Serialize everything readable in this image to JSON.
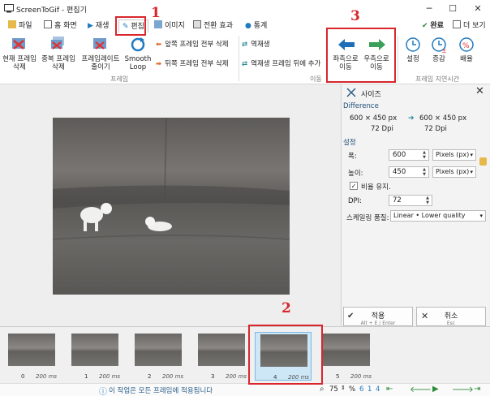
{
  "window": {
    "title": "ScreenToGif - 편집기",
    "controls": {
      "minimize": "─",
      "maximize": "☐",
      "close": "✕"
    }
  },
  "tabs": [
    {
      "label": "파일"
    },
    {
      "label": "홈 화면"
    },
    {
      "label": "재생"
    },
    {
      "label": "편집"
    },
    {
      "label": "이미지"
    },
    {
      "label": "전환 효과"
    },
    {
      "label": "통계"
    }
  ],
  "tabbar_right": {
    "done": "완료",
    "more": "더 보기"
  },
  "ribbon": {
    "frame_group": {
      "label": "프레임",
      "delete_current": "현재 프레임\n삭제",
      "delete_duplicates": "중복 프레임\n삭제",
      "reduce_framerate": "프레임레이트\n줄이기",
      "smooth_loop": "Smooth\nLoop",
      "delete_previous": "앞쪽 프레임 전부 삭제",
      "delete_next": "뒤쪽 프레임 전부 삭제"
    },
    "move_group": {
      "label": "이동",
      "reverse": "역재생",
      "yoyo": "역재생 프레임 뒤에 추가",
      "move_left": "좌측으로\n이동",
      "move_right": "우측으로\n이동"
    },
    "delay_group": {
      "label": "프레임 지연시간",
      "set": "설정",
      "increase": "증감",
      "scale": "배율"
    }
  },
  "panel": {
    "title": "사이즈",
    "difference_label": "Difference",
    "from": {
      "size": "600 × 450 px",
      "dpi": "72 Dpi"
    },
    "to": {
      "size": "600 × 450 px",
      "dpi": "72 Dpi"
    },
    "settings_label": "설정",
    "width_label": "폭:",
    "width_value": "600",
    "width_unit": "Pixels (px)",
    "height_label": "높이:",
    "height_value": "450",
    "height_unit": "Pixels (px)",
    "keep_ratio": "비율 유지.",
    "dpi_label": "DPI:",
    "dpi_value": "72",
    "scaling_label": "스케일링 품질:",
    "scaling_value": "Linear • Lower quality",
    "apply": {
      "label": "적용",
      "shortcut": "Alt + E / Enter"
    },
    "cancel": {
      "label": "취소",
      "shortcut": "Esc"
    }
  },
  "frames": [
    {
      "index": "0",
      "delay": "200 ms"
    },
    {
      "index": "1",
      "delay": "200 ms"
    },
    {
      "index": "2",
      "delay": "200 ms"
    },
    {
      "index": "3",
      "delay": "200 ms"
    },
    {
      "index": "4",
      "delay": "200 ms"
    },
    {
      "index": "5",
      "delay": "200 ms"
    }
  ],
  "status": {
    "message": "이 작업은 모든 프레임에 적용됩니다",
    "zoom": "75",
    "percent": "%",
    "frame_current": "6",
    "frame_total": "1",
    "frame_selected": "4"
  },
  "annotations": {
    "one": "1",
    "two": "2",
    "three": "3"
  },
  "colors": {
    "annotation_red": "#d9262c",
    "accent_blue": "#1f7ac0",
    "nav_green": "#2e8b3a"
  }
}
